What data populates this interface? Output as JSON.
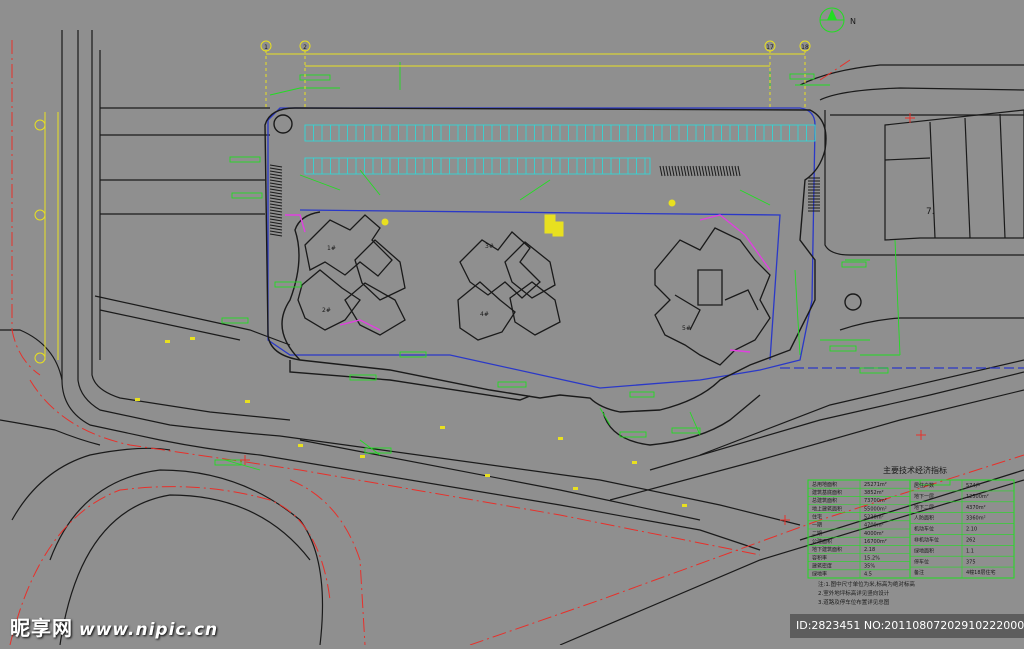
{
  "colors": {
    "background": "#8f8f8f",
    "road": "#1a1a1a",
    "redline": "#e8302a",
    "boundary": "#2a38c8",
    "building": "#1a1a1a",
    "green": "#22dd22",
    "cyan": "#36d4d4",
    "magenta": "#e040e0",
    "yellow": "#e8e020",
    "white_line": "#f0f0f0"
  },
  "grid_axes": [
    "1",
    "2",
    "17",
    "18"
  ],
  "building_labels": [
    "1#",
    "2#",
    "3#",
    "4#",
    "5#"
  ],
  "site_labels": {
    "north_note": "N",
    "existing_building_number": "7."
  },
  "watermark": {
    "brand": "昵享网",
    "site": "www.nipic.cn",
    "id_text": "ID:2823451 NO:20110807202910222000"
  },
  "table": {
    "title": "主要技术经济指标",
    "left_rows": [
      "总用地面积",
      "建筑基底面积",
      "总建筑面积",
      "地上建筑面积",
      "住宅",
      "一期",
      "二期",
      "公建面积",
      "地下建筑面积",
      "容积率",
      "建筑密度",
      "绿地率"
    ],
    "left_values": [
      "25271m²",
      "3852m²",
      "73700m²",
      "55000m²",
      "5230m²",
      "4700m²",
      "4000m²",
      "16700m²",
      "2.18",
      "15.2%",
      "35%",
      "4.5"
    ],
    "right_rows": [
      "居住户数",
      "地下一层",
      "地下二层",
      "人防面积",
      "机动车位",
      "非机动车位",
      "绿地面积",
      "停车位",
      "备注"
    ],
    "right_values": [
      "574户",
      "12500m²",
      "4370m²",
      "3360m²",
      "2.10",
      "262",
      "1.1",
      "375",
      "4幢18层住宅"
    ],
    "notes": [
      "注:1.图中尺寸单位为米,标高为绝对标高",
      "2.室外地坪标高详见竖向设计",
      "3.道路及停车位布置详见总图"
    ]
  }
}
